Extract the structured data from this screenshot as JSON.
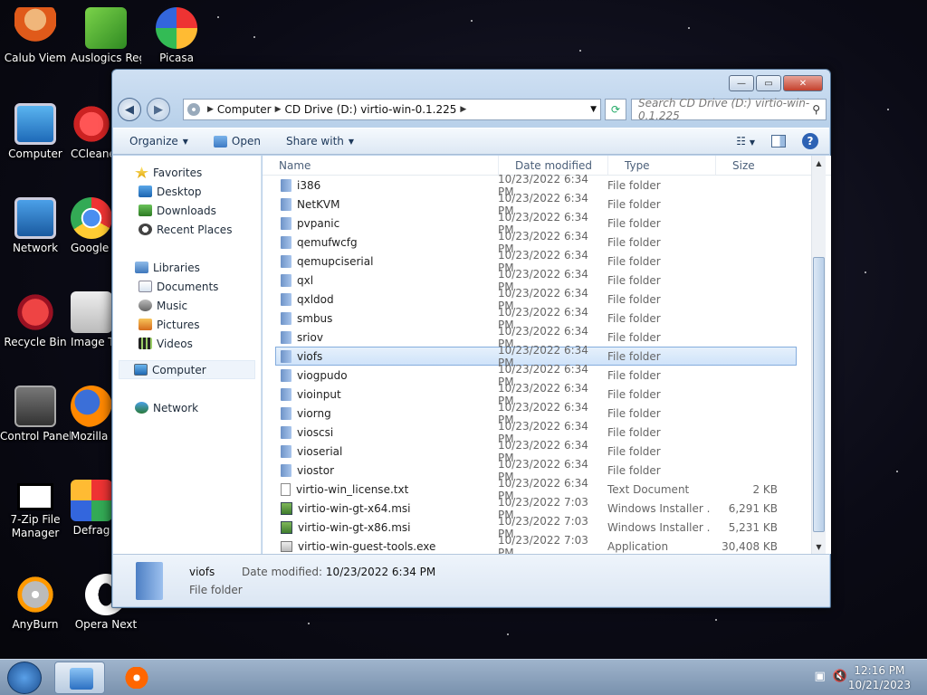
{
  "desktop": {
    "icons": [
      {
        "label": "Calub Viem"
      },
      {
        "label": "Auslogics Registry"
      },
      {
        "label": "Picasa"
      },
      {
        "label": "Computer"
      },
      {
        "label": "CCleaner"
      },
      {
        "label": "Network"
      },
      {
        "label": "Google Chrome"
      },
      {
        "label": "Recycle Bin"
      },
      {
        "label": "Image T"
      },
      {
        "label": "Control Panel"
      },
      {
        "label": "Mozilla Firefox"
      },
      {
        "label": "7-Zip File Manager"
      },
      {
        "label": "Defrag"
      },
      {
        "label": "AnyBurn"
      },
      {
        "label": "Opera Next"
      }
    ]
  },
  "window": {
    "caption": {
      "minimize": "—",
      "maximize": "▭",
      "close": "✕"
    },
    "address": {
      "segments": [
        "Computer",
        "CD Drive (D:) virtio-win-0.1.225"
      ]
    },
    "search": {
      "placeholder": "Search CD Drive (D:) virtio-win-0.1.225"
    },
    "toolbar": {
      "organize": "Organize",
      "open": "Open",
      "share_with": "Share with"
    },
    "navpane": {
      "favorites": "Favorites",
      "desktop": "Desktop",
      "downloads": "Downloads",
      "recent_places": "Recent Places",
      "libraries": "Libraries",
      "documents": "Documents",
      "music": "Music",
      "pictures": "Pictures",
      "videos": "Videos",
      "computer": "Computer",
      "network": "Network"
    },
    "columns": {
      "name": "Name",
      "date": "Date modified",
      "type": "Type",
      "size": "Size"
    },
    "files": [
      {
        "name": "i386",
        "date": "10/23/2022 6:34 PM",
        "type": "File folder",
        "size": "",
        "kind": "folder"
      },
      {
        "name": "NetKVM",
        "date": "10/23/2022 6:34 PM",
        "type": "File folder",
        "size": "",
        "kind": "folder"
      },
      {
        "name": "pvpanic",
        "date": "10/23/2022 6:34 PM",
        "type": "File folder",
        "size": "",
        "kind": "folder"
      },
      {
        "name": "qemufwcfg",
        "date": "10/23/2022 6:34 PM",
        "type": "File folder",
        "size": "",
        "kind": "folder"
      },
      {
        "name": "qemupciserial",
        "date": "10/23/2022 6:34 PM",
        "type": "File folder",
        "size": "",
        "kind": "folder"
      },
      {
        "name": "qxl",
        "date": "10/23/2022 6:34 PM",
        "type": "File folder",
        "size": "",
        "kind": "folder"
      },
      {
        "name": "qxldod",
        "date": "10/23/2022 6:34 PM",
        "type": "File folder",
        "size": "",
        "kind": "folder"
      },
      {
        "name": "smbus",
        "date": "10/23/2022 6:34 PM",
        "type": "File folder",
        "size": "",
        "kind": "folder"
      },
      {
        "name": "sriov",
        "date": "10/23/2022 6:34 PM",
        "type": "File folder",
        "size": "",
        "kind": "folder"
      },
      {
        "name": "viofs",
        "date": "10/23/2022 6:34 PM",
        "type": "File folder",
        "size": "",
        "kind": "folder"
      },
      {
        "name": "viogpudo",
        "date": "10/23/2022 6:34 PM",
        "type": "File folder",
        "size": "",
        "kind": "folder"
      },
      {
        "name": "vioinput",
        "date": "10/23/2022 6:34 PM",
        "type": "File folder",
        "size": "",
        "kind": "folder"
      },
      {
        "name": "viorng",
        "date": "10/23/2022 6:34 PM",
        "type": "File folder",
        "size": "",
        "kind": "folder"
      },
      {
        "name": "vioscsi",
        "date": "10/23/2022 6:34 PM",
        "type": "File folder",
        "size": "",
        "kind": "folder"
      },
      {
        "name": "vioserial",
        "date": "10/23/2022 6:34 PM",
        "type": "File folder",
        "size": "",
        "kind": "folder"
      },
      {
        "name": "viostor",
        "date": "10/23/2022 6:34 PM",
        "type": "File folder",
        "size": "",
        "kind": "folder"
      },
      {
        "name": "virtio-win_license.txt",
        "date": "10/23/2022 6:34 PM",
        "type": "Text Document",
        "size": "2 KB",
        "kind": "txt"
      },
      {
        "name": "virtio-win-gt-x64.msi",
        "date": "10/23/2022 7:03 PM",
        "type": "Windows Installer ...",
        "size": "6,291 KB",
        "kind": "msi"
      },
      {
        "name": "virtio-win-gt-x86.msi",
        "date": "10/23/2022 7:03 PM",
        "type": "Windows Installer ...",
        "size": "5,231 KB",
        "kind": "msi"
      },
      {
        "name": "virtio-win-guest-tools.exe",
        "date": "10/23/2022 7:03 PM",
        "type": "Application",
        "size": "30,408 KB",
        "kind": "exe"
      }
    ],
    "selected_index": 9,
    "details": {
      "name": "viofs",
      "date_label": "Date modified:",
      "date": "10/23/2022 6:34 PM",
      "type": "File folder"
    }
  },
  "taskbar": {
    "time": "12:16 PM",
    "date": "10/21/2023"
  }
}
